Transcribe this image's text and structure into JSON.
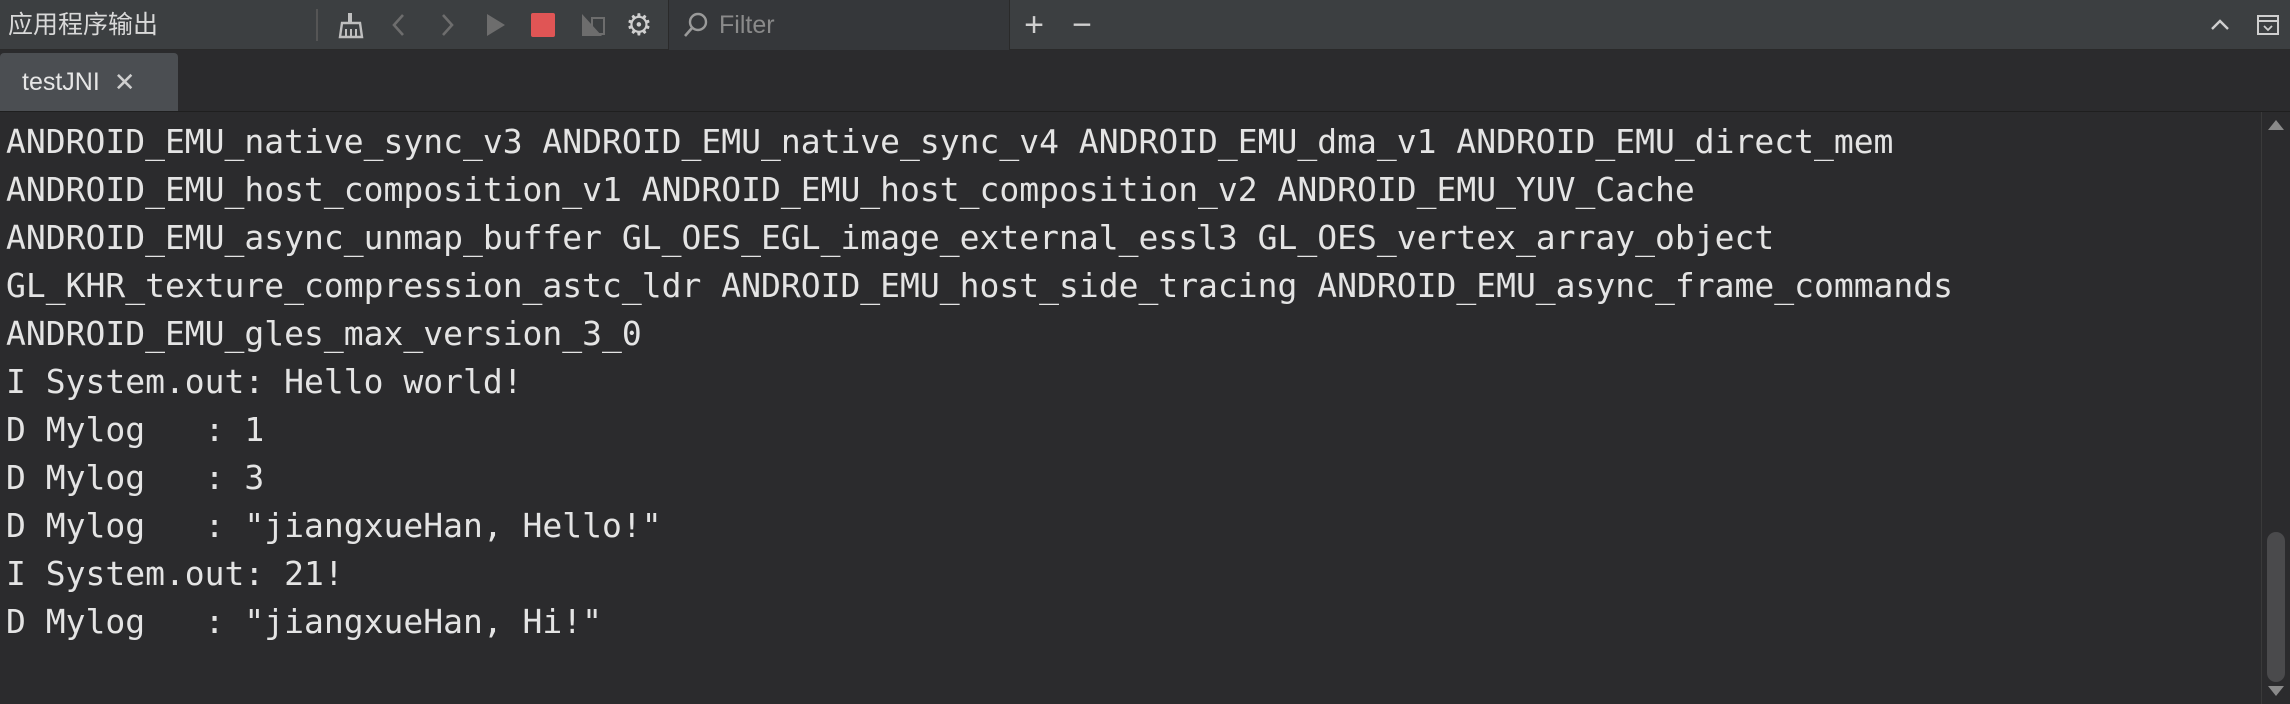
{
  "toolbar": {
    "panel_title": "应用程序输出",
    "filter_placeholder": "Filter",
    "icons": [
      "clear-icon",
      "back-icon",
      "forward-icon",
      "run-icon",
      "stop-icon",
      "build-icon",
      "settings-icon",
      "search-icon",
      "add-icon",
      "remove-icon",
      "collapse-icon",
      "maximize-icon"
    ],
    "plus": "+",
    "minus": "−"
  },
  "tabs": [
    {
      "label": "testJNI",
      "close": "✕"
    }
  ],
  "console": {
    "lines": [
      "ANDROID_EMU_native_sync_v3 ANDROID_EMU_native_sync_v4 ANDROID_EMU_dma_v1 ANDROID_EMU_direct_mem",
      "ANDROID_EMU_host_composition_v1 ANDROID_EMU_host_composition_v2 ANDROID_EMU_YUV_Cache",
      "ANDROID_EMU_async_unmap_buffer GL_OES_EGL_image_external_essl3 GL_OES_vertex_array_object",
      "GL_KHR_texture_compression_astc_ldr ANDROID_EMU_host_side_tracing ANDROID_EMU_async_frame_commands",
      "ANDROID_EMU_gles_max_version_3_0",
      "I System.out: Hello world!",
      "D Mylog   : 1",
      "D Mylog   : 3",
      "D Mylog   : \"jiangxueHan, Hello!\"",
      "I System.out: 21!",
      "D Mylog   : \"jiangxueHan, Hi!\""
    ]
  },
  "colors": {
    "background": "#2b2b2d",
    "toolbar": "#3c3f41",
    "stop": "#e05555",
    "text": "#e4e4e4"
  }
}
